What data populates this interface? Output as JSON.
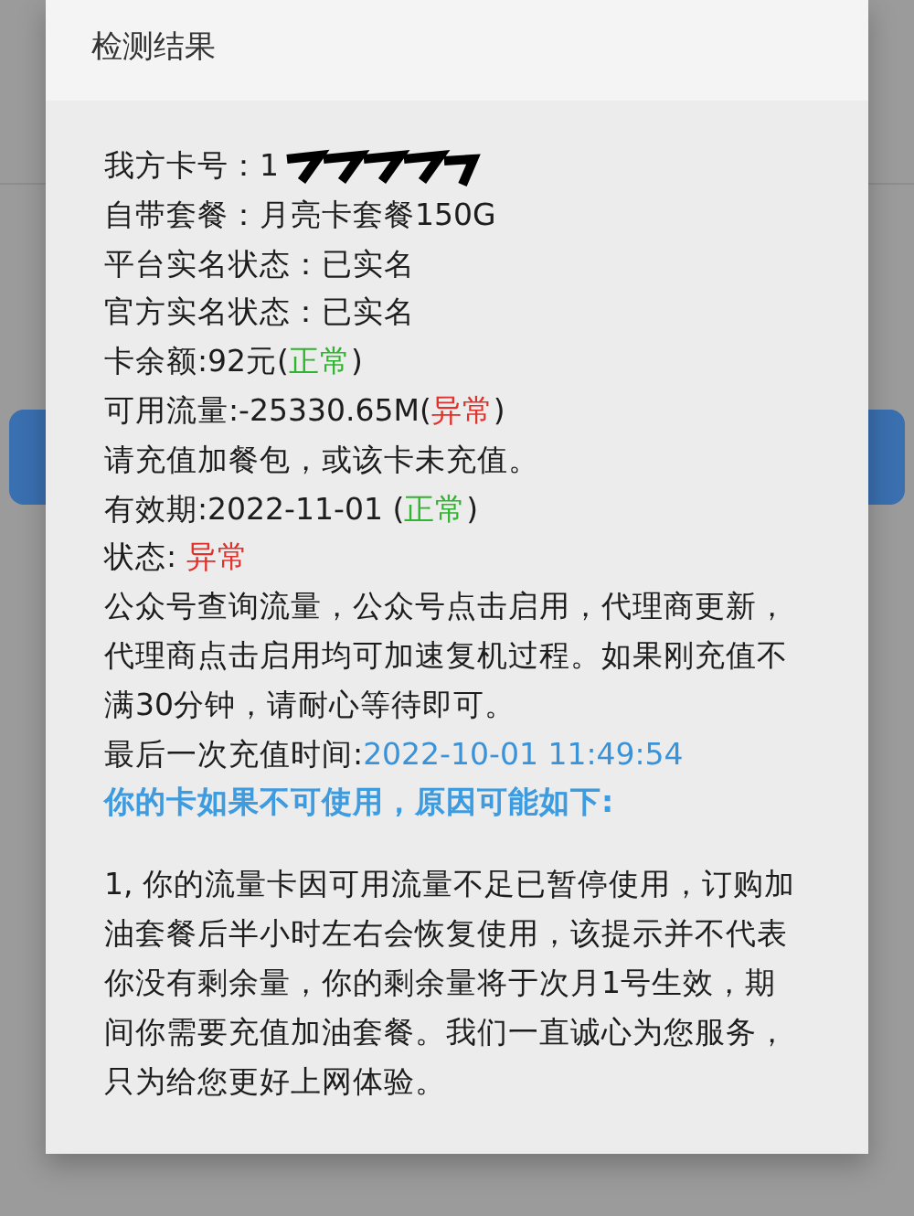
{
  "dialog": {
    "title": "检测结果",
    "lines": [
      {
        "kind": "redacted",
        "parts": [
          {
            "text": "我方卡号：",
            "color": "#1d1d1d"
          },
          {
            "text": "1",
            "color": "#1d1d1d"
          }
        ]
      },
      {
        "kind": "plain",
        "parts": [
          {
            "text": "自带套餐：月亮卡套餐150G",
            "color": "#1d1d1d"
          }
        ]
      },
      {
        "kind": "plain",
        "parts": [
          {
            "text": "平台实名状态：已实名",
            "color": "#1d1d1d"
          }
        ]
      },
      {
        "kind": "plain",
        "parts": [
          {
            "text": "官方实名状态：已实名",
            "color": "#1d1d1d"
          }
        ]
      },
      {
        "kind": "plain",
        "parts": [
          {
            "text": "卡余额:92元(",
            "color": "#1d1d1d"
          },
          {
            "text": "正常",
            "color": "#2fb52f"
          },
          {
            "text": ")",
            "color": "#1d1d1d"
          }
        ]
      },
      {
        "kind": "plain",
        "parts": [
          {
            "text": "可用流量:-25330.65M(",
            "color": "#1d1d1d"
          },
          {
            "text": "异常",
            "color": "#e0322d"
          },
          {
            "text": ")",
            "color": "#1d1d1d"
          }
        ]
      },
      {
        "kind": "plain",
        "parts": [
          {
            "text": "请充值加餐包，或该卡未充值。",
            "color": "#1d1d1d"
          }
        ]
      },
      {
        "kind": "plain",
        "parts": [
          {
            "text": "有效期:2022-11-01 (",
            "color": "#1d1d1d"
          },
          {
            "text": "正常",
            "color": "#2fb52f"
          },
          {
            "text": ")",
            "color": "#1d1d1d"
          }
        ]
      },
      {
        "kind": "plain",
        "parts": [
          {
            "text": "状态: ",
            "color": "#1d1d1d"
          },
          {
            "text": "异常",
            "color": "#e0322d"
          }
        ]
      },
      {
        "kind": "plain",
        "parts": [
          {
            "text": "公众号查询流量，公众号点击启用，代理商更新，代理商点击启用均可加速复机过程。如果刚充值不满30分钟，请耐心等待即可。",
            "color": "#1d1d1d"
          }
        ]
      },
      {
        "kind": "plain",
        "parts": [
          {
            "text": "最后一次充值时间:",
            "color": "#1d1d1d"
          },
          {
            "text": "2022-10-01 11:49:54",
            "color": "#3a93d8"
          }
        ]
      }
    ],
    "heading": "你的卡如果不可使用，原因可能如下:",
    "notice": "1, 你的流量卡因可用流量不足已暂停使用，订购加油套餐后半小时左右会恢复使用，该提示并不代表你没有剩余量，你的剩余量将于次月1号生效，期间你需要充值加油套餐。我们一直诚心为您服务，只为给您更好上网体验。"
  }
}
